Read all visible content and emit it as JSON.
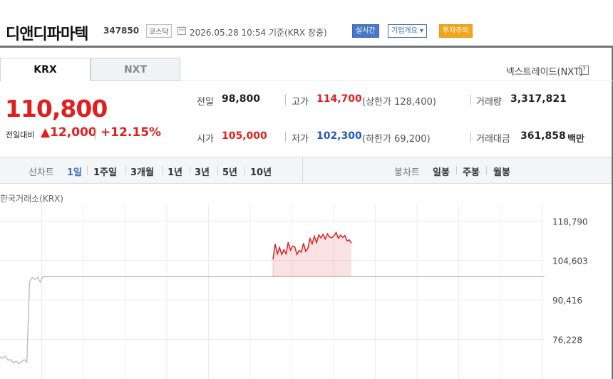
{
  "header": {
    "company": "디앤디파마텍",
    "code": "347850",
    "market": "코스닥",
    "datetime": "2026.05.28 10:54",
    "basis": "기준(KRX 장중)",
    "badges": {
      "live": "실시간",
      "info": "기업개요 ▾",
      "warn": "투자주의"
    },
    "icons": {
      "clock": "clock-icon"
    }
  },
  "tabs": [
    {
      "label": "KRX",
      "active": true
    },
    {
      "label": "NXT",
      "active": false
    }
  ],
  "nxt_trade": "넥스트레이드(NXT)",
  "quote": {
    "price": "110,800",
    "change_label": "전일대비",
    "change": "▲12,000",
    "change_rate": "+12.15%",
    "color_up": "#e02020"
  },
  "stats": {
    "prev_label": "전일",
    "prev": "98,800",
    "open_label": "시가",
    "open": "105,000",
    "high_label": "고가",
    "high": "114,700",
    "upper_limit": "(상한가 128,400)",
    "low_label": "저가",
    "low": "102,300",
    "lower_limit": "(하한가 69,200)",
    "volume_label": "거래량",
    "volume": "3,317,821",
    "amount_label": "거래대금",
    "amount": "361,858",
    "amount_unit": "백만"
  },
  "period_bar": {
    "line_label": "선차트",
    "line_periods": [
      "1일",
      "1주일",
      "3개월",
      "1년",
      "3년",
      "5년",
      "10년"
    ],
    "active": "1일",
    "candle_label": "봉차트",
    "candle_periods": [
      "일봉",
      "주봉",
      "월봉"
    ]
  },
  "chart_data": {
    "type": "line",
    "title": "한국거래소(KRX)",
    "y_ticks": [
      "118,790",
      "104,603",
      "90,416",
      "76,228"
    ],
    "y_tick_values": [
      118790,
      104603,
      90416,
      76228
    ],
    "baseline": 98800,
    "ylim": [
      62041,
      125000
    ],
    "grid": true,
    "series": [
      {
        "color": "#bbbbbb",
        "style": "history",
        "values": [
          70000,
          69500,
          70200,
          68800,
          69000,
          67800,
          68500,
          67500,
          68200,
          69000,
          68000,
          97000,
          98500,
          97800,
          98600,
          96800,
          98800,
          98800
        ]
      },
      {
        "color": "#e02020",
        "style": "intraday",
        "values": [
          105000,
          110500,
          107000,
          109300,
          106800,
          108500,
          107000,
          111200,
          108300,
          109800,
          109500,
          106800,
          108200,
          107600,
          110800,
          107900,
          109000,
          112500,
          110600,
          113300,
          111000,
          113800,
          112700,
          114000,
          112300,
          114200,
          113000,
          112800,
          113500,
          114700,
          112600,
          113700,
          112900,
          113600,
          111700,
          112000,
          110800
        ]
      }
    ]
  },
  "colors": {
    "up": "#e02020",
    "accent": "#3f6cc4",
    "warn": "#f0a51f"
  }
}
